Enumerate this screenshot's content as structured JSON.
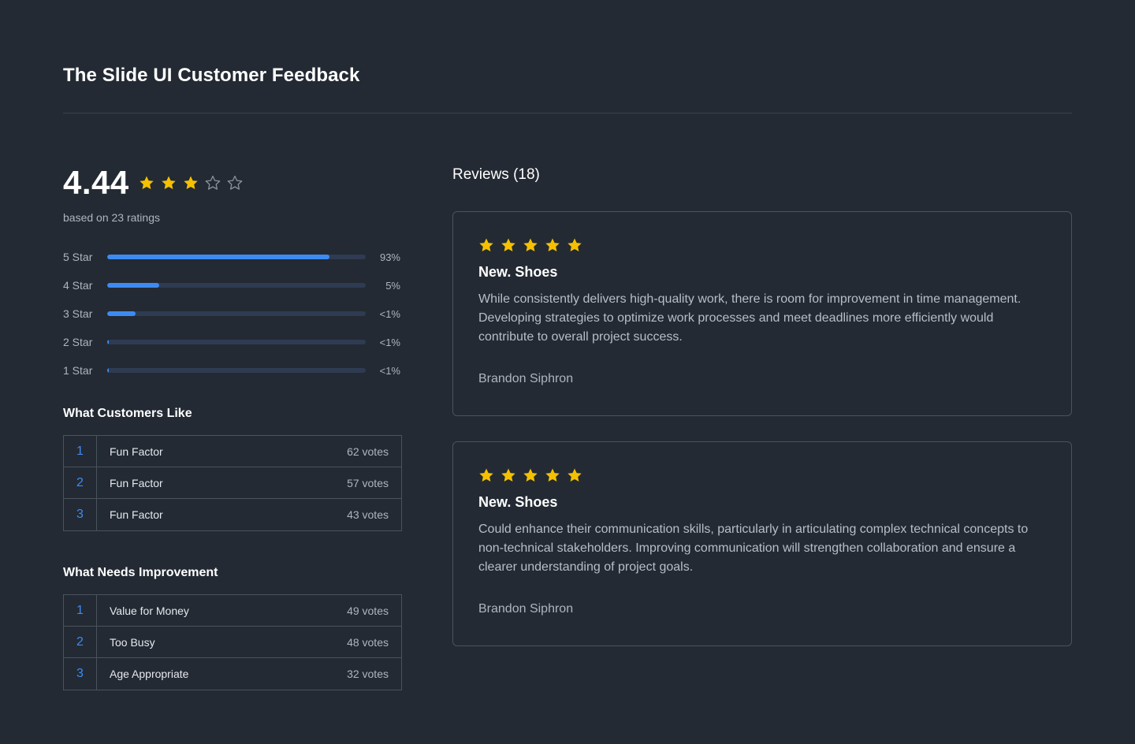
{
  "header": {
    "title": "The Slide UI Customer Feedback"
  },
  "summary": {
    "score": "4.44",
    "stars_filled": 3,
    "stars_total": 5,
    "based_on": "based on 23 ratings"
  },
  "colors": {
    "accent": "#3d8bf2",
    "star": "#f5c000",
    "star_empty": "#8a929c",
    "background": "#232a33"
  },
  "breakdown": [
    {
      "label": "5 Star",
      "pct_text": "93%",
      "fill": 0.86
    },
    {
      "label": "4 Star",
      "pct_text": "5%",
      "fill": 0.2
    },
    {
      "label": "3 Star",
      "pct_text": "<1%",
      "fill": 0.11
    },
    {
      "label": "2 Star",
      "pct_text": "<1%",
      "fill": 0.006
    },
    {
      "label": "1 Star",
      "pct_text": "<1%",
      "fill": 0.006
    }
  ],
  "likes": {
    "title": "What Customers Like",
    "items": [
      {
        "rank": "1",
        "name": "Fun Factor",
        "votes": "62 votes"
      },
      {
        "rank": "2",
        "name": "Fun Factor",
        "votes": "57 votes"
      },
      {
        "rank": "3",
        "name": "Fun Factor",
        "votes": "43 votes"
      }
    ]
  },
  "improvements": {
    "title": "What Needs Improvement",
    "items": [
      {
        "rank": "1",
        "name": "Value for Money",
        "votes": "49 votes"
      },
      {
        "rank": "2",
        "name": "Too Busy",
        "votes": "48 votes"
      },
      {
        "rank": "3",
        "name": "Age Appropriate",
        "votes": "32 votes"
      }
    ]
  },
  "reviews": {
    "title": "Reviews (18)",
    "items": [
      {
        "stars": 5,
        "title": "New. Shoes",
        "body": "While consistently delivers high-quality work, there is room for improvement in time management. Developing strategies to optimize work processes and meet deadlines more efficiently would contribute to overall project success.",
        "author": "Brandon Siphron"
      },
      {
        "stars": 5,
        "title": "New. Shoes",
        "body": "Could enhance their communication skills, particularly in articulating complex technical concepts to non-technical stakeholders. Improving communication will strengthen collaboration and ensure a clearer understanding of project goals.",
        "author": "Brandon Siphron"
      }
    ]
  }
}
